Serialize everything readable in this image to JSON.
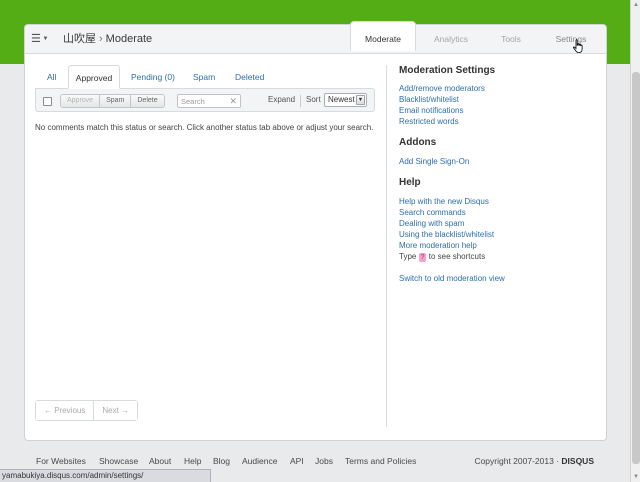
{
  "header": {
    "menu_icon": "hamburger-menu-icon",
    "site_name": "山吹屋",
    "separator": "›",
    "section": "Moderate"
  },
  "top_tabs": [
    {
      "label": "Moderate",
      "active": true
    },
    {
      "label": "Analytics",
      "active": false
    },
    {
      "label": "Tools",
      "active": false
    },
    {
      "label": "Settings",
      "active": false
    }
  ],
  "status_tabs": [
    {
      "label": "All",
      "active": false
    },
    {
      "label": "Approved",
      "active": true
    },
    {
      "label": "Pending (0)",
      "active": false
    },
    {
      "label": "Spam",
      "active": false
    },
    {
      "label": "Deleted",
      "active": false
    }
  ],
  "actions": {
    "approve": "Approve",
    "spam": "Spam",
    "delete": "Delete",
    "search_placeholder": "Search",
    "search_value": "",
    "clear_glyph": "✕",
    "expand": "Expand",
    "sort_label": "Sort",
    "sort_value": "Newest"
  },
  "empty_message": "No comments match this status or search. Click another status tab above or adjust your search.",
  "pager": {
    "previous": "← Previous",
    "next": "Next →"
  },
  "sidebar": {
    "moderation_settings": {
      "title": "Moderation Settings",
      "links": [
        "Add/remove moderators",
        "Blacklist/whitelist",
        "Email notifications",
        "Restricted words"
      ]
    },
    "addons": {
      "title": "Addons",
      "links": [
        "Add Single Sign-On"
      ]
    },
    "help": {
      "title": "Help",
      "links": [
        "Help with the new Disqus",
        "Search commands",
        "Dealing with spam",
        "Using the blacklist/whitelist",
        "More moderation help"
      ],
      "shortcut_prefix": "Type",
      "shortcut_key": "?",
      "shortcut_suffix": "to see shortcuts",
      "switch_link": "Switch to old moderation view"
    }
  },
  "footer": {
    "links": [
      "For Websites",
      "Showcase",
      "About",
      "Help",
      "Blog",
      "Audience",
      "API",
      "Jobs",
      "Terms and Policies"
    ],
    "copyright": "Copyright 2007-2013 ·",
    "brand": "DISQUS"
  },
  "browser_status_url": "yamabukiya.disqus.com/admin/settings/",
  "colors": {
    "header_green": "#54ad14",
    "link_blue": "#2e6fa8",
    "shortcut_pink": "#f5a1c8"
  }
}
